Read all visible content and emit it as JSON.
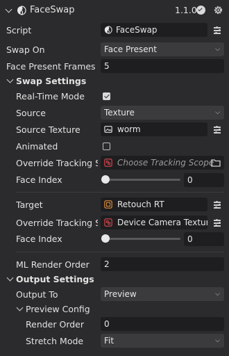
{
  "header": {
    "title": "FaceSwap",
    "version": "1.1.0"
  },
  "script": {
    "label": "Script",
    "value": "FaceSwap"
  },
  "swap_on": {
    "label": "Swap On",
    "value": "Face Present"
  },
  "face_present_frames": {
    "label": "Face Present Frames",
    "value": "5"
  },
  "swap_settings": {
    "title": "Swap Settings",
    "real_time_mode": {
      "label": "Real-Time Mode",
      "checked": true
    },
    "source": {
      "label": "Source",
      "value": "Texture"
    },
    "source_texture": {
      "label": "Source Texture",
      "value": "worm"
    },
    "animated": {
      "label": "Animated",
      "checked": false
    },
    "override_tracking_source": {
      "label": "Override Tracking Sc",
      "value": "Choose Tracking Scope"
    },
    "face_index_source": {
      "label": "Face Index",
      "value": "0"
    },
    "target": {
      "label": "Target",
      "value": "Retouch RT"
    },
    "override_tracking_target": {
      "label": "Override Tracking Sc",
      "value": "Device Camera Texture T"
    },
    "face_index_target": {
      "label": "Face Index",
      "value": "0"
    },
    "ml_render_order": {
      "label": "ML Render Order",
      "value": "2"
    }
  },
  "output_settings": {
    "title": "Output Settings",
    "output_to": {
      "label": "Output To",
      "value": "Preview"
    },
    "preview_config": {
      "title": "Preview Config",
      "render_order": {
        "label": "Render Order",
        "value": "0"
      },
      "stretch_mode": {
        "label": "Stretch Mode",
        "value": "Fit"
      }
    }
  },
  "colors": {
    "panel_bg": "#2b2b2d",
    "field_bg": "#1e1e20",
    "select_bg": "#3b3b3e",
    "accent_red": "#e0484e",
    "accent_orange": "#e8923a"
  }
}
